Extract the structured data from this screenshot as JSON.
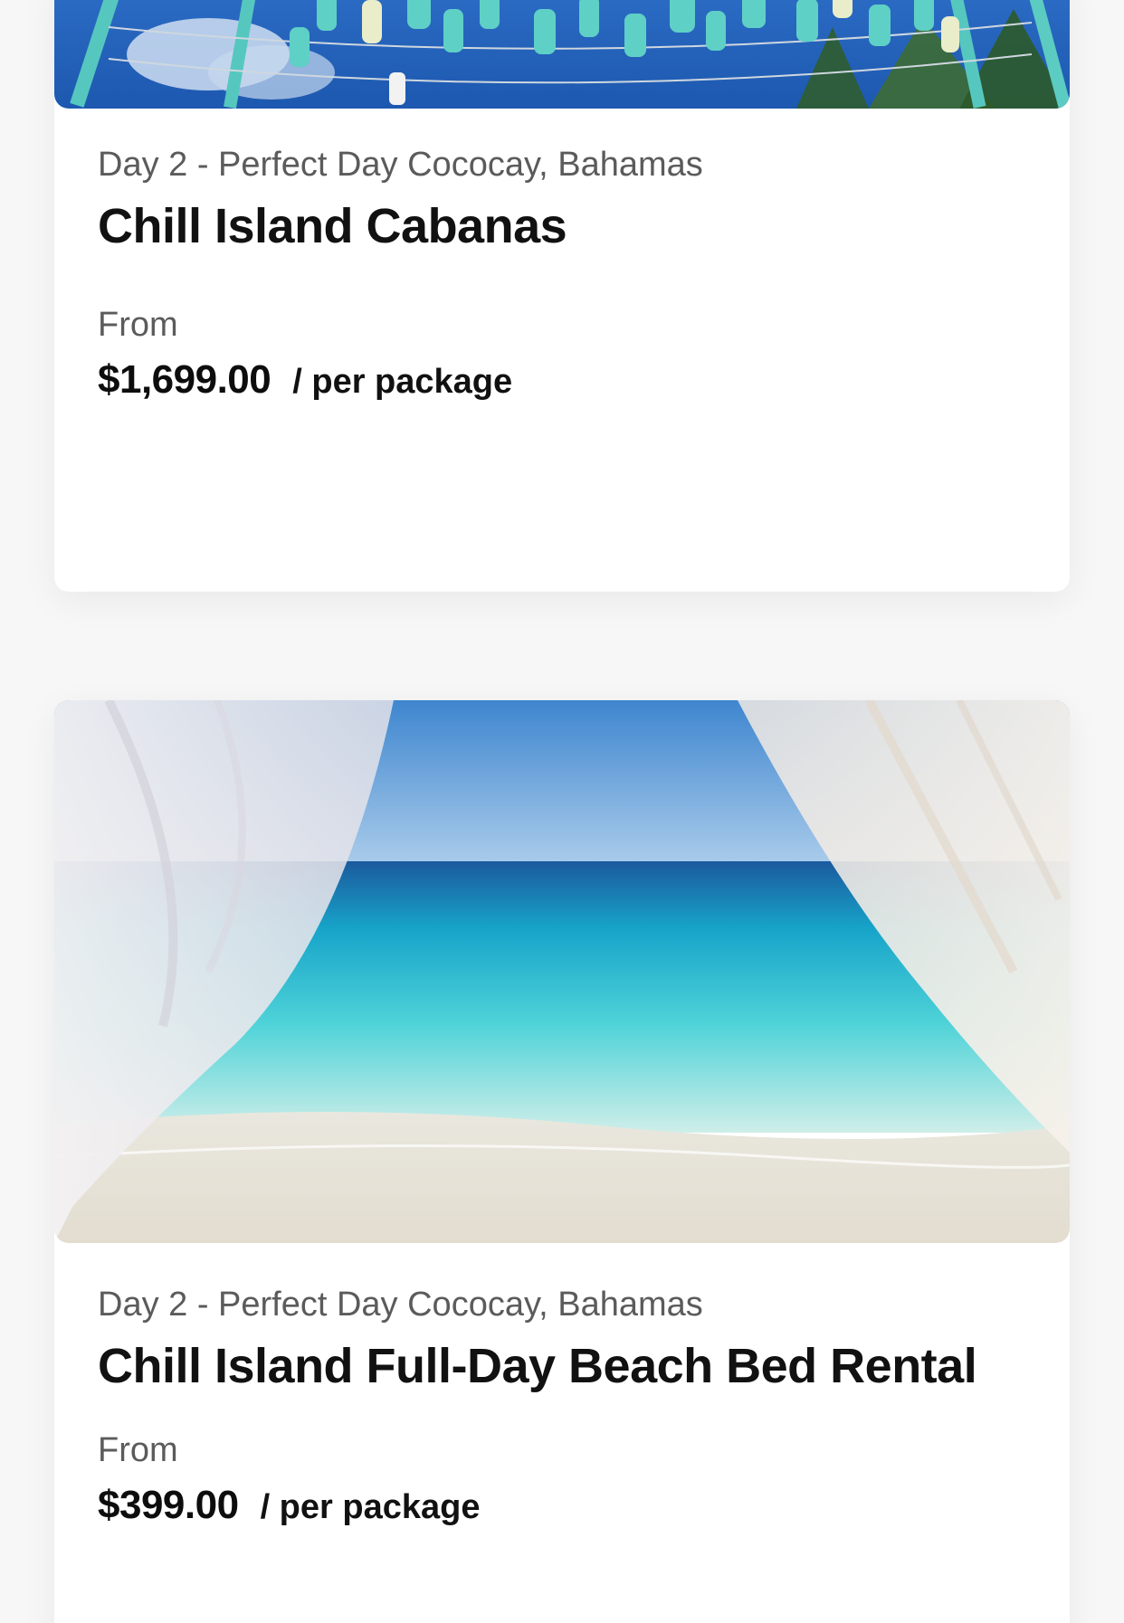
{
  "cards": [
    {
      "subtitle": "Day 2 - Perfect Day Cococay, Bahamas",
      "title": "Chill Island Cabanas",
      "from_label": "From",
      "price": "$1,699.00",
      "per_label": "/ per package",
      "image_alt": "turquoise buoys hanging over beach"
    },
    {
      "subtitle": "Day 2 - Perfect Day Cococay, Bahamas",
      "title": "Chill Island Full-Day Beach Bed Rental",
      "from_label": "From",
      "price": "$399.00",
      "per_label": "/ per package",
      "image_alt": "ocean view framed by white curtains"
    }
  ],
  "colors": {
    "text_primary": "#111111",
    "text_secondary": "#5b5b5b",
    "card_bg": "#ffffff",
    "page_bg": "#f7f7f7"
  }
}
